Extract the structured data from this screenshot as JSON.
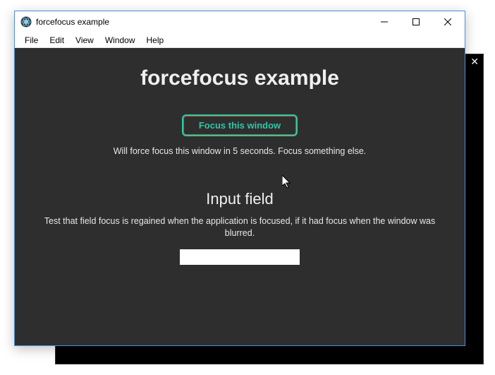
{
  "window": {
    "title": "forcefocus example"
  },
  "menu": {
    "items": [
      "File",
      "Edit",
      "View",
      "Window",
      "Help"
    ]
  },
  "page": {
    "heading": "forcefocus example",
    "focus_button": "Focus this window",
    "focus_description": "Will force focus this window in 5 seconds. Focus something else.",
    "input_heading": "Input field",
    "input_description": "Test that field focus is regained when the application is focused, if it had focus when the window was blurred.",
    "input_value": ""
  }
}
